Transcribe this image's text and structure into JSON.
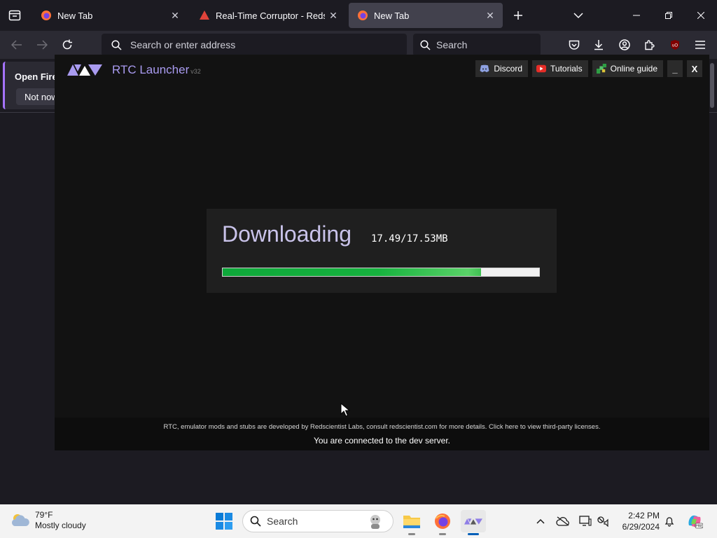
{
  "browser": {
    "tabs": [
      {
        "title": "New Tab",
        "favicon": "firefox-icon",
        "active": false
      },
      {
        "title": "Real-Time Corruptor - Redscientist",
        "favicon": "redscientist-icon",
        "active": false
      },
      {
        "title": "New Tab",
        "favicon": "firefox-icon",
        "active": true
      }
    ],
    "url_placeholder": "Search or enter address",
    "search_placeholder": "Search",
    "notification": {
      "title": "Open Firef",
      "button": "Not now"
    }
  },
  "rtc": {
    "title": "RTC Launcher",
    "version": "v32",
    "links": {
      "discord": "Discord",
      "tutorials": "Tutorials",
      "guide": "Online guide"
    },
    "minimize": "_",
    "close": "X",
    "download": {
      "label": "Downloading",
      "size_text": "17.49/17.53MB",
      "progress": 0.816
    },
    "footer": {
      "credits": "RTC, emulator mods and stubs are developed by Redscientist Labs, consult redscientist.com for more details. Click here to view third-party licenses.",
      "status": "You are connected to the dev server."
    }
  },
  "taskbar": {
    "weather": {
      "temp": "79°F",
      "desc": "Mostly cloudy"
    },
    "search_placeholder": "Search",
    "time": "2:42 PM",
    "date": "6/29/2024"
  },
  "colors": {
    "rtc_accent": "#a99bf0",
    "progress_green": "#16b23e",
    "firefox_bg": "#1c1b22"
  }
}
